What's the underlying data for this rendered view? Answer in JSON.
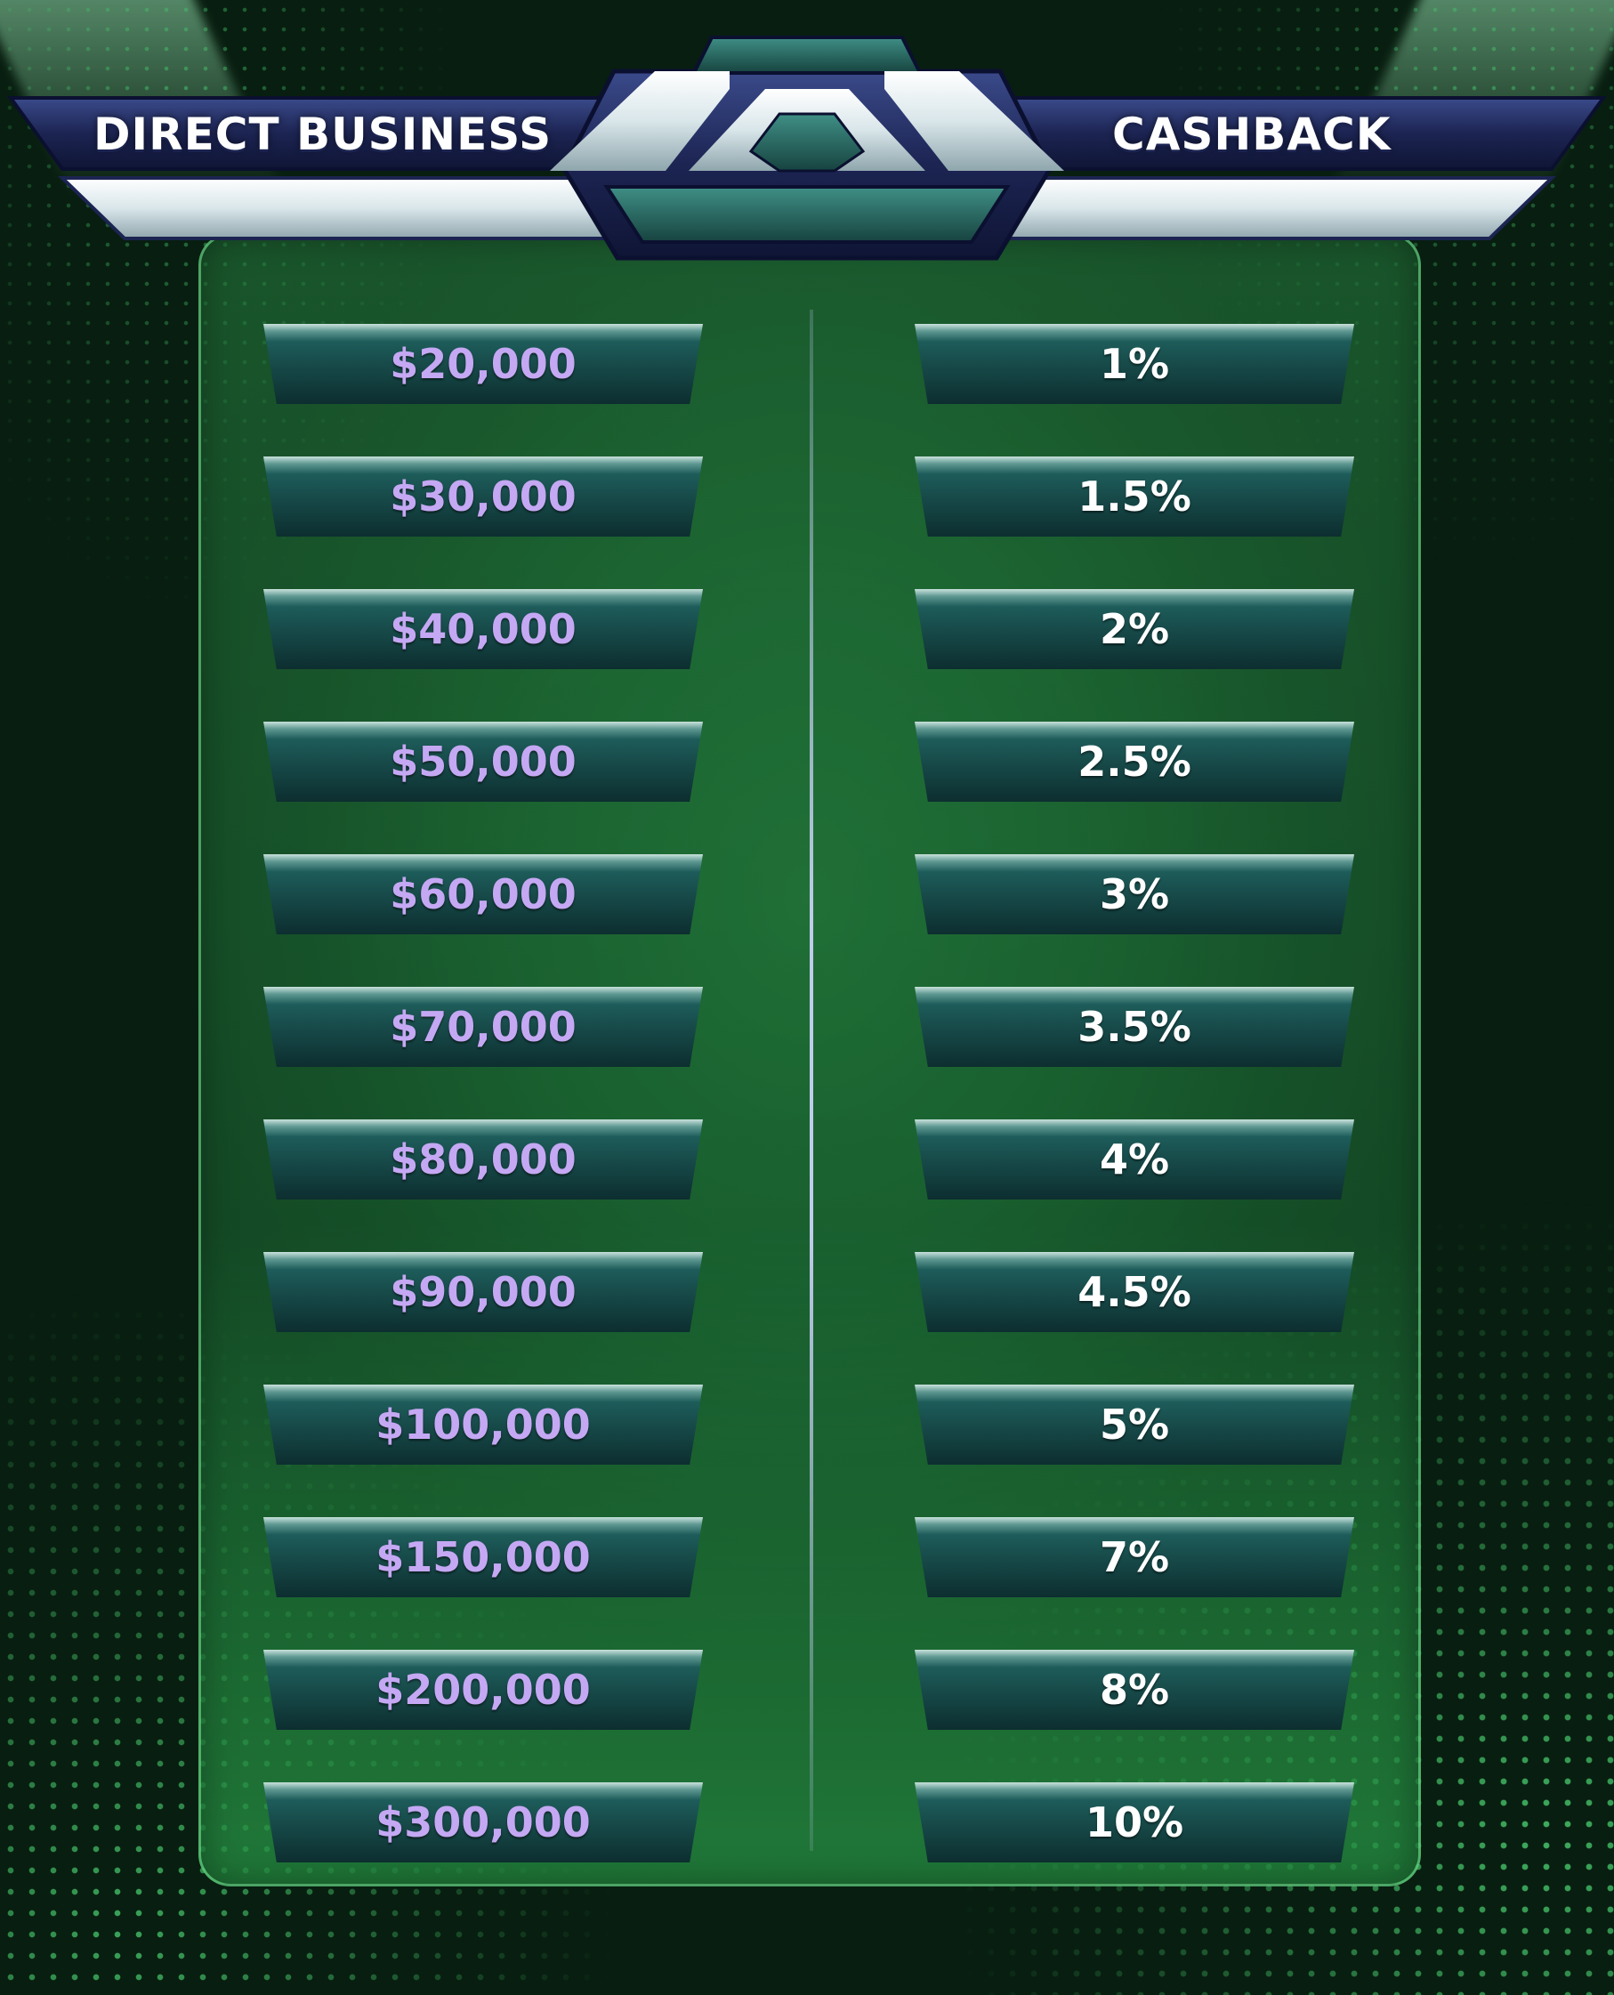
{
  "header": {
    "left_title": "DIRECT BUSINESS",
    "right_title": "CASHBACK"
  },
  "table": {
    "rows": [
      {
        "business": "$20,000",
        "cashback": "1%"
      },
      {
        "business": "$30,000",
        "cashback": "1.5%"
      },
      {
        "business": "$40,000",
        "cashback": "2%"
      },
      {
        "business": "$50,000",
        "cashback": "2.5%"
      },
      {
        "business": "$60,000",
        "cashback": "3%"
      },
      {
        "business": "$70,000",
        "cashback": "3.5%"
      },
      {
        "business": "$80,000",
        "cashback": "4%"
      },
      {
        "business": "$90,000",
        "cashback": "4.5%"
      },
      {
        "business": "$100,000",
        "cashback": "5%"
      },
      {
        "business": "$150,000",
        "cashback": "7%"
      },
      {
        "business": "$200,000",
        "cashback": "8%"
      },
      {
        "business": "$300,000",
        "cashback": "10%"
      }
    ]
  },
  "colors": {
    "amount_text": "#c5a8f3",
    "rate_text": "#ffffff",
    "background": "#134d25"
  }
}
